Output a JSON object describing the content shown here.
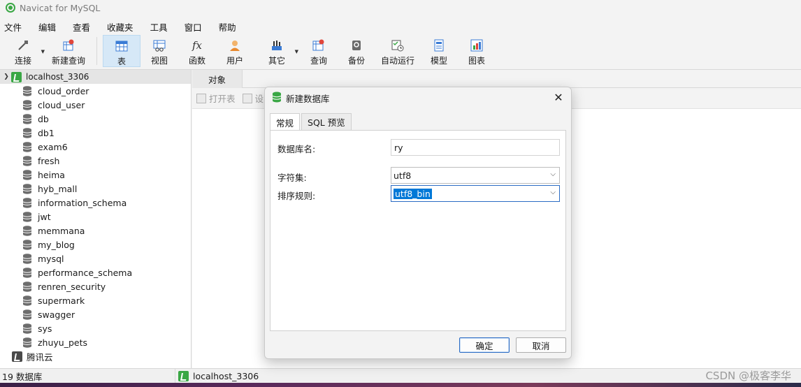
{
  "window": {
    "title": "Navicat for MySQL"
  },
  "menu": [
    "文件",
    "编辑",
    "查看",
    "收藏夹",
    "工具",
    "窗口",
    "帮助"
  ],
  "toolbar": {
    "items": [
      {
        "label": "连接",
        "icon": "connect-icon"
      },
      {
        "label": "新建查询",
        "icon": "new-query-icon"
      },
      {
        "label": "表",
        "icon": "table-icon",
        "active": true
      },
      {
        "label": "视图",
        "icon": "view-icon"
      },
      {
        "label": "函数",
        "icon": "function-icon",
        "glyph": "fx"
      },
      {
        "label": "用户",
        "icon": "user-icon"
      },
      {
        "label": "其它",
        "icon": "other-icon"
      },
      {
        "label": "查询",
        "icon": "query-icon"
      },
      {
        "label": "备份",
        "icon": "backup-icon"
      },
      {
        "label": "自动运行",
        "icon": "automation-icon"
      },
      {
        "label": "模型",
        "icon": "model-icon"
      },
      {
        "label": "图表",
        "icon": "chart-icon"
      }
    ]
  },
  "sidebar": {
    "connection": "localhost_3306",
    "databases": [
      "cloud_order",
      "cloud_user",
      "db",
      "db1",
      "exam6",
      "fresh",
      "heima",
      "hyb_mall",
      "information_schema",
      "jwt",
      "memmana",
      "my_blog",
      "mysql",
      "performance_schema",
      "renren_security",
      "supermark",
      "swagger",
      "sys",
      "zhuyu_pets"
    ],
    "other_connection": "腾讯云"
  },
  "objects": {
    "tab": "对象",
    "tools": [
      "打开表",
      "设"
    ]
  },
  "dialog": {
    "title": "新建数据库",
    "tabs": [
      "常规",
      "SQL 预览"
    ],
    "fields": {
      "name_label": "数据库名:",
      "name_value": "ry",
      "charset_label": "字符集:",
      "charset_value": "utf8",
      "collation_label": "排序规则:",
      "collation_value": "utf8_bin"
    },
    "ok": "确定",
    "cancel": "取消"
  },
  "status": {
    "count": "19 数据库",
    "connection": "localhost_3306"
  },
  "watermark": "CSDN @极客李华",
  "colors": {
    "accent": "#0078d7",
    "navicat_green": "#3aa745",
    "active_tool_bg": "#d6e8f7"
  }
}
